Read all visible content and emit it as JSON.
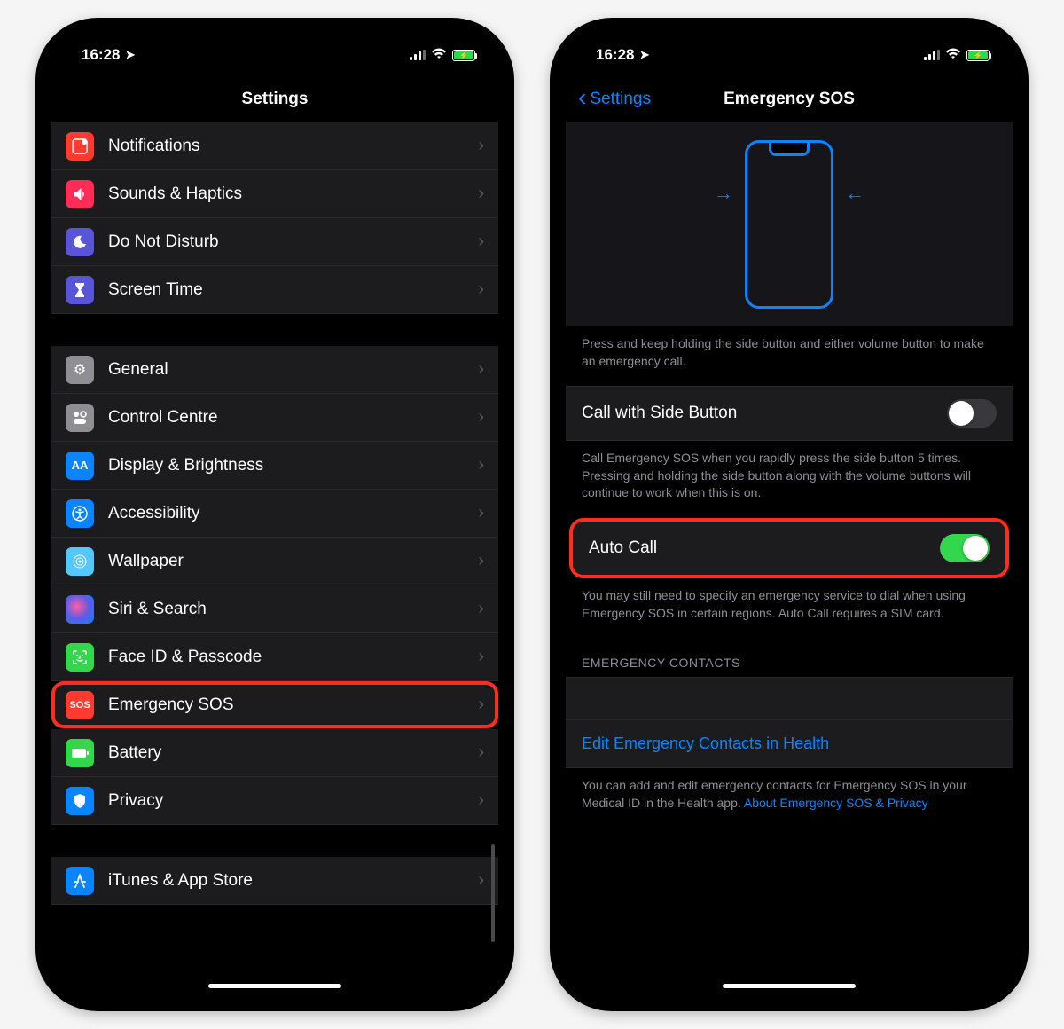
{
  "status": {
    "time": "16:28"
  },
  "left_screen": {
    "title": "Settings",
    "group1": [
      {
        "label": "Notifications",
        "icon": "notifications",
        "color": "#ff3b30"
      },
      {
        "label": "Sounds & Haptics",
        "icon": "sounds",
        "color": "#ff2d55"
      },
      {
        "label": "Do Not Disturb",
        "icon": "dnd",
        "color": "#5e5ce6"
      },
      {
        "label": "Screen Time",
        "icon": "screentime",
        "color": "#5e5ce6"
      }
    ],
    "group2": [
      {
        "label": "General",
        "icon": "gear",
        "color": "#8e8e93"
      },
      {
        "label": "Control Centre",
        "icon": "control",
        "color": "#8e8e93"
      },
      {
        "label": "Display & Brightness",
        "icon": "display",
        "color": "#0a84ff"
      },
      {
        "label": "Accessibility",
        "icon": "accessibility",
        "color": "#0a84ff"
      },
      {
        "label": "Wallpaper",
        "icon": "wallpaper",
        "color": "#54c7fc"
      },
      {
        "label": "Siri & Search",
        "icon": "siri",
        "color": "#1c1c1e"
      },
      {
        "label": "Face ID & Passcode",
        "icon": "faceid",
        "color": "#32d74b"
      },
      {
        "label": "Emergency SOS",
        "icon": "sos",
        "color": "#ff3b30",
        "highlight": true
      },
      {
        "label": "Battery",
        "icon": "battery",
        "color": "#32d74b"
      },
      {
        "label": "Privacy",
        "icon": "privacy",
        "color": "#0a84ff"
      }
    ],
    "group3": [
      {
        "label": "iTunes & App Store",
        "icon": "appstore",
        "color": "#0a84ff"
      }
    ]
  },
  "right_screen": {
    "back_label": "Settings",
    "title": "Emergency SOS",
    "illustration_caption": "Press and keep holding the side button and either volume button to make an emergency call.",
    "side_button": {
      "label": "Call with Side Button",
      "on": false
    },
    "side_button_footer": "Call Emergency SOS when you rapidly press the side button 5 times. Pressing and holding the side button along with the volume buttons will continue to work when this is on.",
    "auto_call": {
      "label": "Auto Call",
      "on": true,
      "highlight": true
    },
    "auto_call_footer": "You may still need to specify an emergency service to dial when using Emergency SOS in certain regions. Auto Call requires a SIM card.",
    "contacts_header": "EMERGENCY CONTACTS",
    "edit_link": "Edit Emergency Contacts in Health",
    "contacts_footer": "You can add and edit emergency contacts for Emergency SOS in your Medical ID in the Health app.",
    "privacy_link": "About Emergency SOS & Privacy"
  }
}
